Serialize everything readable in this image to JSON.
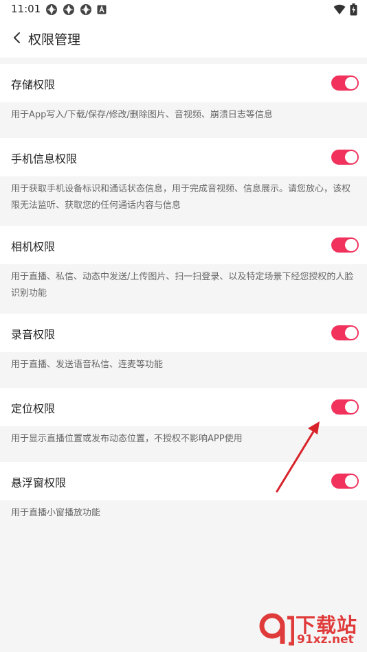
{
  "status_bar": {
    "time": "11:01",
    "left_icons": [
      "photos-icon",
      "photos-icon",
      "photos-icon",
      "font-a-icon"
    ],
    "right_icons": [
      "wifi-icon",
      "battery-charging-icon"
    ]
  },
  "header": {
    "title": "权限管理"
  },
  "permissions": [
    {
      "label": "存储权限",
      "description": "用于App写入/下载/保存/修改/删除图片、音视频、崩溃日志等信息",
      "enabled": true
    },
    {
      "label": "手机信息权限",
      "description": "用于获取手机设备标识和通话状态信息，用于完成音视频、信息展示。请您放心，该权限无法监听、获取您的任何通话内容与信息",
      "enabled": true
    },
    {
      "label": "相机权限",
      "description": "用于直播、私信、动态中发送/上传图片、扫一扫登录、以及特定场景下经您授权的人脸识别功能",
      "enabled": true
    },
    {
      "label": "录音权限",
      "description": "用于直播、发送语音私信、连麦等功能",
      "enabled": true
    },
    {
      "label": "定位权限",
      "description": "用于显示直播位置或发布动态位置，不授权不影响APP使用",
      "enabled": true
    },
    {
      "label": "悬浮窗权限",
      "description": "用于直播小窗播放功能",
      "enabled": true
    }
  ],
  "colors": {
    "toggle_on": "#f0325d",
    "annotation_arrow": "#d8222a",
    "watermark": "#e03b3b"
  },
  "watermark": {
    "text_main": "下载站",
    "text_site": "91xz.net"
  }
}
